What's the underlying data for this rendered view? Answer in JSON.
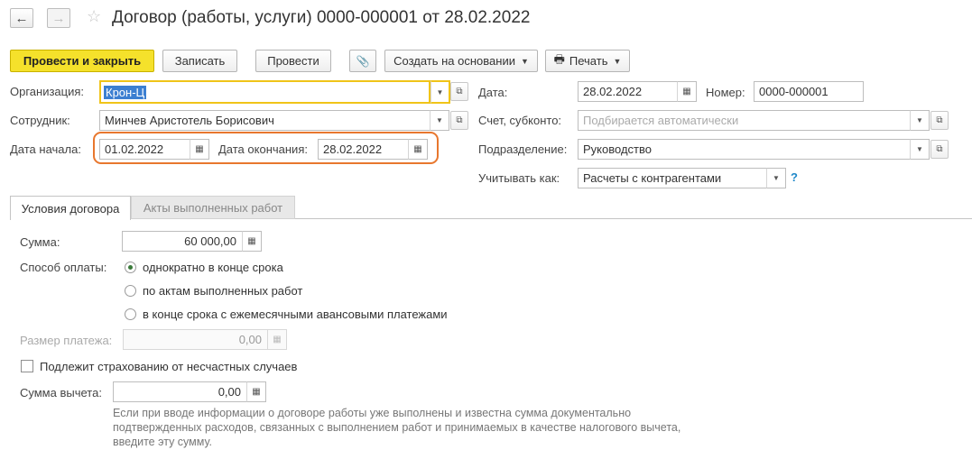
{
  "window": {
    "title": "Договор (работы, услуги) 0000-000001 от 28.02.2022",
    "back_icon": "←",
    "forward_icon": "→",
    "star_icon": "☆"
  },
  "toolbar": {
    "post_close": "Провести и закрыть",
    "save": "Записать",
    "post": "Провести",
    "attach_icon": "📎",
    "create_based": "Создать на основании",
    "print_icon": "🖶",
    "print": "Печать"
  },
  "form": {
    "org_label": "Организация:",
    "org_value": "Крон-Ц",
    "employee_label": "Сотрудник:",
    "employee_value": "Минчев Аристотель Борисович",
    "start_label": "Дата начала:",
    "start_value": "01.02.2022",
    "end_label": "Дата окончания:",
    "end_value": "28.02.2022",
    "date_label": "Дата:",
    "date_value": "28.02.2022",
    "number_label": "Номер:",
    "number_value": "0000-000001",
    "account_label": "Счет, субконто:",
    "account_placeholder": "Подбирается автоматически",
    "dept_label": "Подразделение:",
    "dept_value": "Руководство",
    "account_as_label": "Учитывать как:",
    "account_as_value": "Расчеты с контрагентами",
    "help": "?"
  },
  "tabs": {
    "conditions": "Условия договора",
    "acts": "Акты выполненных работ"
  },
  "conditions": {
    "sum_label": "Сумма:",
    "sum_value": "60 000,00",
    "payment_label": "Способ оплаты:",
    "payment_options": [
      "однократно в конце срока",
      "по актам выполненных работ",
      "в конце срока с ежемесячными авансовыми платежами"
    ],
    "payment_size_label": "Размер платежа:",
    "payment_size_value": "0,00",
    "insurance_label": "Подлежит страхованию от несчастных случаев",
    "deduction_label": "Сумма вычета:",
    "deduction_value": "0,00",
    "hint": "Если при вводе информации о договоре работы уже выполнены и известна сумма документально подтвержденных расходов, связанных с выполнением работ и принимаемых в качестве налогового вычета, введите эту сумму."
  },
  "colors": {
    "primary_button": "#f5e12b",
    "highlight_frame": "#e8772e",
    "focus_border": "#f0c419",
    "selection": "#3c7fd1"
  }
}
